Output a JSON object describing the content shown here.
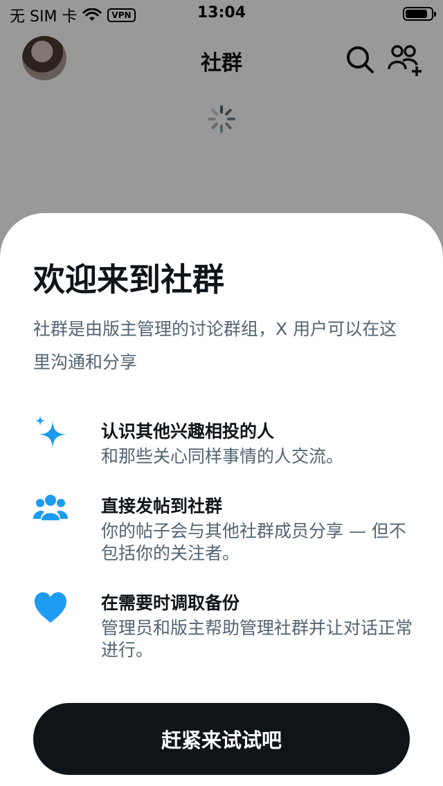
{
  "status_bar": {
    "carrier": "无 SIM 卡",
    "vpn": "VPN",
    "time": "13:04",
    "battery_level": 0.85
  },
  "nav": {
    "title": "社群"
  },
  "sheet": {
    "title": "欢迎来到社群",
    "description": "社群是由版主管理的讨论群组，X 用户可以在这里沟通和分享",
    "features": [
      {
        "icon": "sparkle-icon",
        "title": "认识其他兴趣相投的人",
        "text": "和那些关心同样事情的人交流。"
      },
      {
        "icon": "people-icon",
        "title": "直接发帖到社群",
        "text": "你的帖子会与其他社群成员分享 — 但不包括你的关注者。"
      },
      {
        "icon": "heart-icon",
        "title": "在需要时调取备份",
        "text": "管理员和版主帮助管理社群并让对话正常进行。"
      }
    ],
    "cta_label": "赶紧来试试吧"
  },
  "colors": {
    "accent_blue": "#1d9bf0",
    "text_primary": "#0f1419",
    "text_secondary": "#536471",
    "button_bg": "#0f1419"
  }
}
